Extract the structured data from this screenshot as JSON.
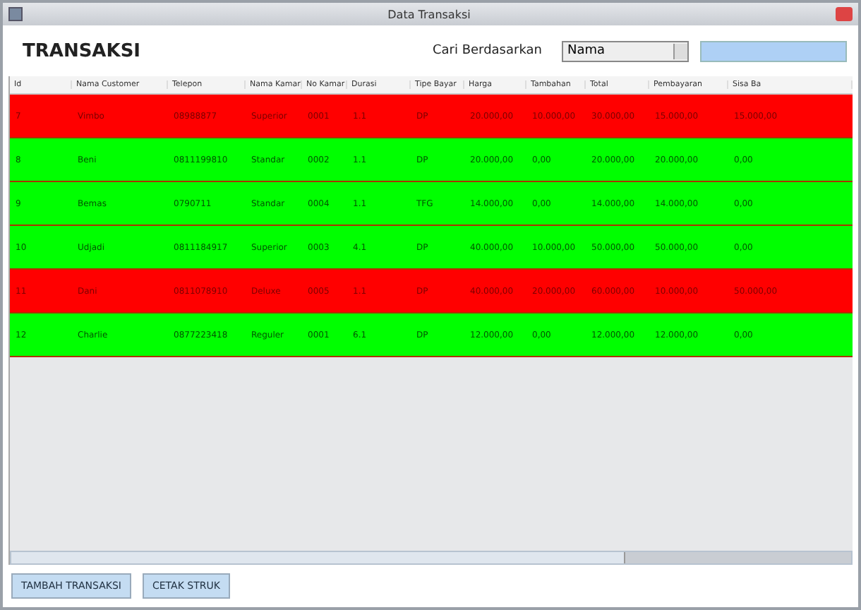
{
  "window": {
    "title": "Data Transaksi"
  },
  "heading": "TRANSAKSI",
  "search": {
    "label": "Cari Berdasarkan",
    "dropdown": "Nama"
  },
  "table": {
    "columns": [
      "Id",
      "Nama Customer",
      "Telepon",
      "Nama Kamar",
      "No Kamar",
      "Durasi",
      "Tipe Bayar",
      "Harga",
      "Tambahan",
      "Total",
      "Pembayaran",
      "Sisa Ba"
    ],
    "rows": [
      {
        "color": "#ff0000",
        "cells": [
          "7",
          "Vimbo",
          "08988877",
          "Superior",
          "0001",
          "1.1",
          "DP",
          "20.000,00",
          "10.000,00",
          "30.000,00",
          "15.000,00",
          "15.000,00"
        ]
      },
      {
        "color": "#00ff00",
        "cells": [
          "8",
          "Beni",
          "0811199810",
          "Standar",
          "0002",
          "1.1",
          "DP",
          "20.000,00",
          "0,00",
          "20.000,00",
          "20.000,00",
          "0,00"
        ]
      },
      {
        "color": "#00ff00",
        "cells": [
          "9",
          "Bemas",
          "0790711",
          "Standar",
          "0004",
          "1.1",
          "TFG",
          "14.000,00",
          "0,00",
          "14.000,00",
          "14.000,00",
          "0,00"
        ]
      },
      {
        "color": "#00ff00",
        "cells": [
          "10",
          "Udjadi",
          "0811184917",
          "Superior",
          "0003",
          "4.1",
          "DP",
          "40.000,00",
          "10.000,00",
          "50.000,00",
          "50.000,00",
          "0,00"
        ]
      },
      {
        "color": "#ff0000",
        "cells": [
          "11",
          "Dani",
          "0811078910",
          "Deluxe",
          "0005",
          "1.1",
          "DP",
          "40.000,00",
          "20.000,00",
          "60.000,00",
          "10.000,00",
          "50.000,00"
        ]
      },
      {
        "color": "#00ff00",
        "cells": [
          "12",
          "Charlie",
          "0877223418",
          "Reguler",
          "0001",
          "6.1",
          "DP",
          "12.000,00",
          "0,00",
          "12.000,00",
          "12.000,00",
          "0,00"
        ]
      }
    ]
  },
  "buttons": [
    "TAMBAH TRANSAKSI",
    "CETAK STRUK"
  ]
}
